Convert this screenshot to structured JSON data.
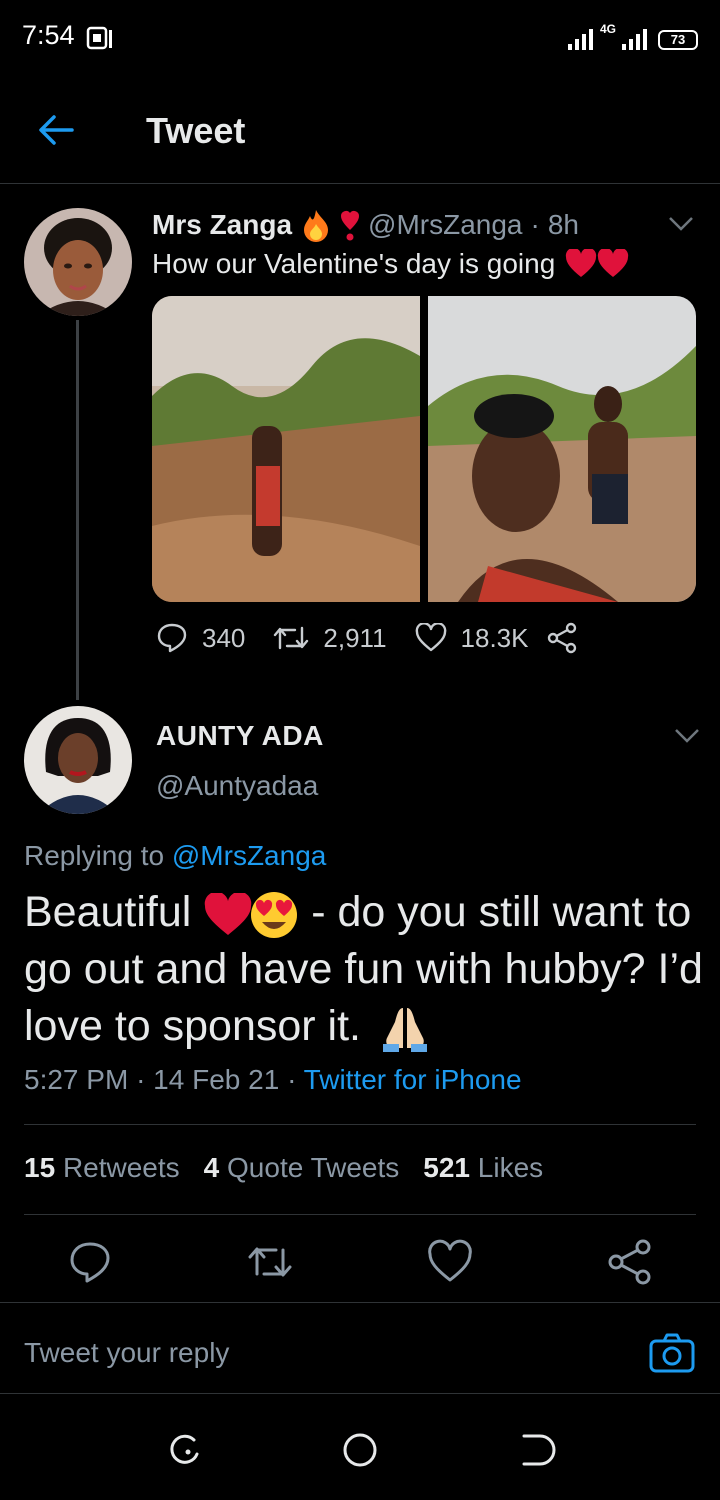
{
  "status_bar": {
    "time": "7:54",
    "network": "4G",
    "battery": "73"
  },
  "header": {
    "title": "Tweet"
  },
  "parent_tweet": {
    "display_name": "Mrs Zanga",
    "name_emojis": [
      "fire-emoji",
      "exclamation-heart-emoji"
    ],
    "handle": "@MrsZanga",
    "separator": "·",
    "time_ago": "8h",
    "text": "How our Valentine's day is going",
    "text_emojis": [
      "red-heart-emoji",
      "red-heart-emoji"
    ],
    "replies": "340",
    "retweets": "2,911",
    "likes": "18.3K"
  },
  "main_tweet": {
    "display_name": "AUNTY ADA",
    "handle": "@Auntyadaa",
    "replying_prefix": "Replying to",
    "replying_to": "@MrsZanga",
    "text_part1": "Beautiful",
    "text_part2": "- do you still want to go out and have fun with hubby? I’d love to sponsor it.",
    "body_emojis": [
      "red-heart-emoji",
      "heart-eyes-emoji",
      "folded-hands-emoji"
    ],
    "time": "5:27 PM",
    "date": "14 Feb 21",
    "dot": "·",
    "source": "Twitter for iPhone",
    "retweets_count": "15",
    "retweets_label": "Retweets",
    "quotes_count": "4",
    "quotes_label": "Quote Tweets",
    "likes_count": "521",
    "likes_label": "Likes"
  },
  "reply_bar": {
    "placeholder": "Tweet your reply"
  },
  "colors": {
    "background": "#000000",
    "accent": "#1d9bf0",
    "muted": "#8b98a5",
    "divider": "#2f3336"
  }
}
